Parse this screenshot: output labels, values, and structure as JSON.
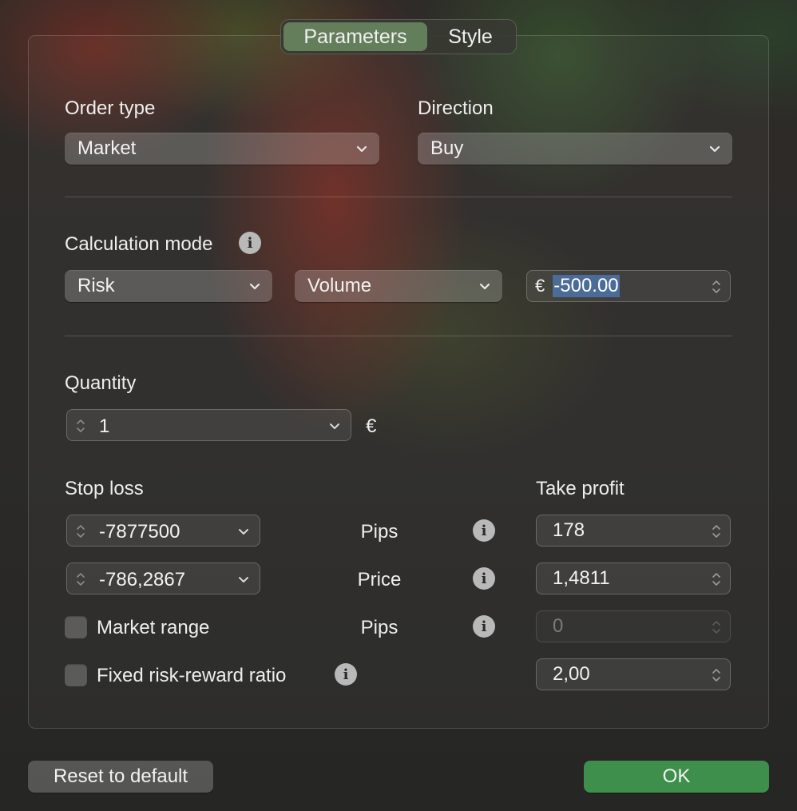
{
  "tabs": {
    "parameters": "Parameters",
    "style": "Style",
    "active": "Parameters"
  },
  "order_type": {
    "label": "Order type",
    "value": "Market"
  },
  "direction": {
    "label": "Direction",
    "value": "Buy"
  },
  "calculation_mode": {
    "label": "Calculation mode",
    "mode": "Risk",
    "basis": "Volume",
    "currency_symbol": "€",
    "amount": "-500.00"
  },
  "quantity": {
    "label": "Quantity",
    "value": "1",
    "unit": "€"
  },
  "stop_loss": {
    "label": "Stop loss",
    "pips_value": "-7877500",
    "price_value": "-786,2867"
  },
  "take_profit": {
    "label": "Take profit",
    "pips_value": "178",
    "price_value": "1,4811",
    "market_range_value": "0",
    "ratio_value": "2,00"
  },
  "row_labels": {
    "pips": "Pips",
    "price": "Price",
    "market_pips": "Pips"
  },
  "market_range": {
    "label": "Market range",
    "checked": false
  },
  "fixed_rr": {
    "label": "Fixed risk-reward ratio",
    "checked": false
  },
  "buttons": {
    "reset": "Reset to default",
    "ok": "OK"
  },
  "colors": {
    "accent_ok": "#3f8f4c",
    "active_tab": "#739669",
    "selection": "#4b6b98"
  }
}
